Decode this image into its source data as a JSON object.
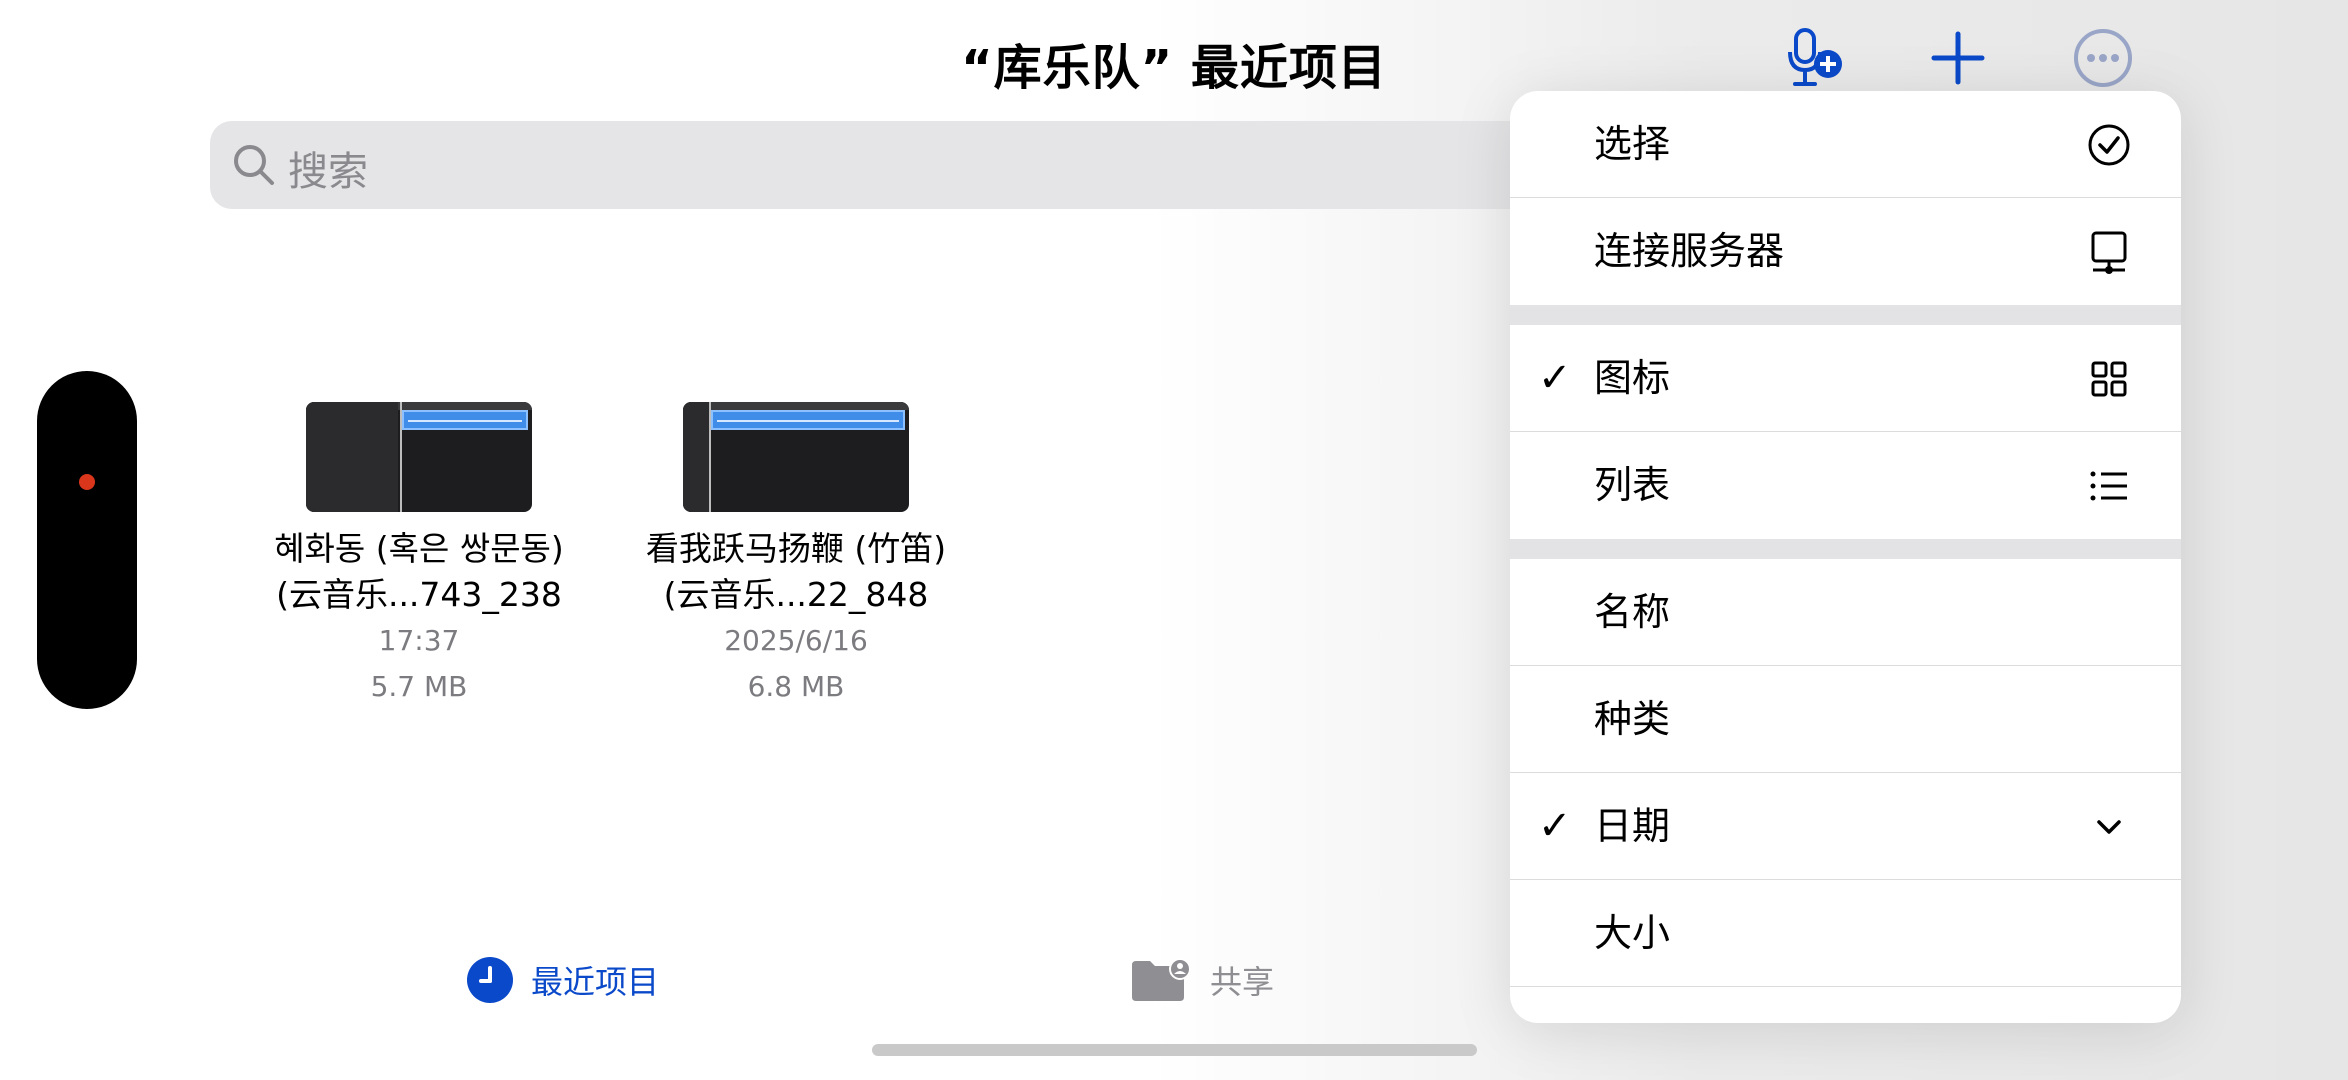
{
  "header": {
    "title": "“库乐队” 最近项目",
    "icons": [
      "mic-plus-icon",
      "plus-icon",
      "more-icon"
    ]
  },
  "search": {
    "placeholder": "搜索"
  },
  "files": [
    {
      "name_line1": "혜화동 (혹은 쌍문동)",
      "name_line2": "(云音乐...743_238",
      "date": "17:37",
      "size": "5.7 MB"
    },
    {
      "name_line1": "看我跃马扬鞭 (竹笛)",
      "name_line2": "(云音乐...22_848",
      "date": "2025/6/16",
      "size": "6.8 MB"
    }
  ],
  "tabs": [
    {
      "label": "最近项目",
      "icon": "clock-icon",
      "active": true
    },
    {
      "label": "共享",
      "icon": "shared-folder-icon",
      "active": false
    }
  ],
  "menu": {
    "items": [
      {
        "label": "选择",
        "checked": false,
        "icon": "checkmark-circle-icon"
      },
      {
        "label": "连接服务器",
        "checked": false,
        "icon": "server-display-icon"
      },
      {
        "label": "图标",
        "checked": true,
        "icon": "grid-icon"
      },
      {
        "label": "列表",
        "checked": false,
        "icon": "list-icon"
      },
      {
        "label": "名称",
        "checked": false
      },
      {
        "label": "种类",
        "checked": false
      },
      {
        "label": "日期",
        "checked": true,
        "icon": "chevron-down-icon"
      },
      {
        "label": "大小",
        "checked": false
      }
    ],
    "check_mark": "✓"
  },
  "colors": {
    "accent": "#0a49c9",
    "recorder_dot": "#d9361c",
    "search_bg": "#e5e5e7",
    "meta_text": "#7c7c80"
  }
}
